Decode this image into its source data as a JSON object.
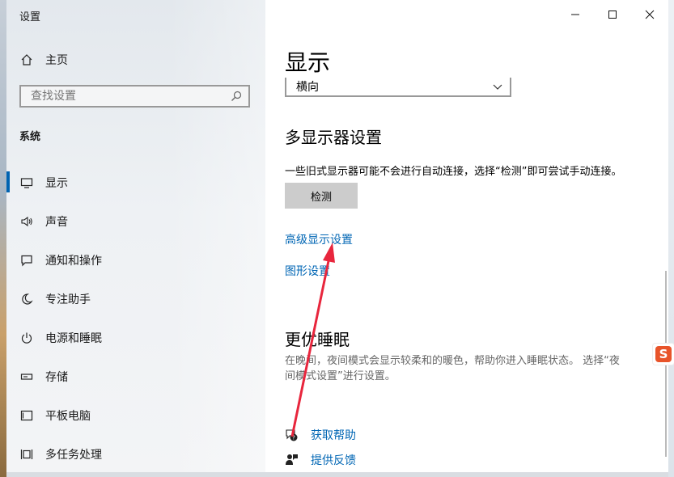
{
  "window": {
    "title": "设置"
  },
  "sidebar": {
    "home_label": "主页",
    "search_placeholder": "查找设置",
    "section": "系统",
    "items": [
      {
        "label": "显示",
        "icon": "monitor-icon",
        "active": true
      },
      {
        "label": "声音",
        "icon": "speaker-icon"
      },
      {
        "label": "通知和操作",
        "icon": "notification-icon"
      },
      {
        "label": "专注助手",
        "icon": "moon-icon"
      },
      {
        "label": "电源和睡眠",
        "icon": "power-icon"
      },
      {
        "label": "存储",
        "icon": "storage-icon"
      },
      {
        "label": "平板电脑",
        "icon": "tablet-icon"
      },
      {
        "label": "多任务处理",
        "icon": "multitask-icon"
      }
    ]
  },
  "main": {
    "page_title": "显示",
    "orientation_value": "横向",
    "multi_display": {
      "heading": "多显示器设置",
      "description": "一些旧式显示器可能不会进行自动连接，选择“检测”即可尝试手动连接。",
      "detect_button": "检测"
    },
    "links": {
      "advanced_display": "高级显示设置",
      "graphics_settings": "图形设置"
    },
    "sleep": {
      "heading": "更优睡眠",
      "description_line1": "在晚间，夜间模式会显示较柔和的暖色，帮助你进入睡眠状态。 选择“夜",
      "description_line2": "间模式设置”进行设置。"
    },
    "help": {
      "get_help": "获取帮助",
      "feedback": "提供反馈"
    }
  },
  "ime_badge": "S",
  "colors": {
    "accent": "#0063b1",
    "link": "#0066b4",
    "annotation_arrow": "#e8263d"
  }
}
